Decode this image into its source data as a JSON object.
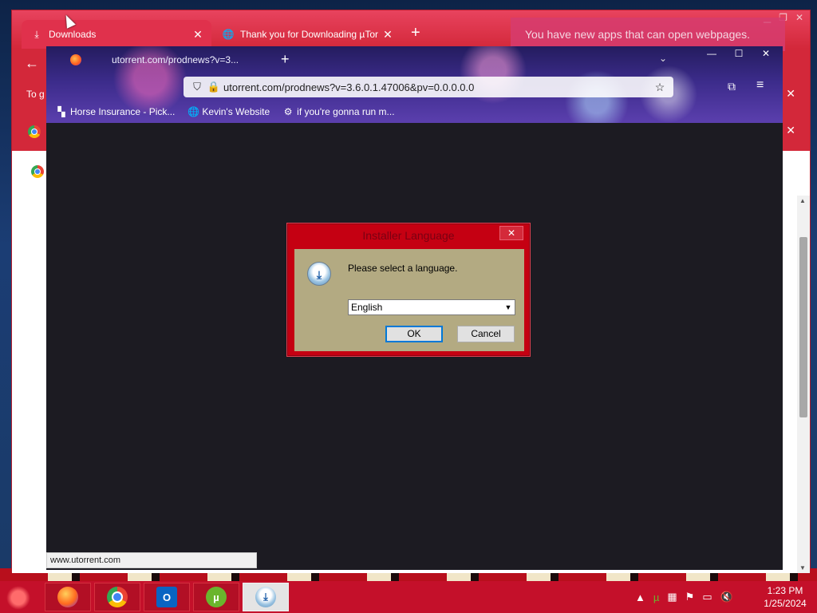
{
  "chrome": {
    "tabs": [
      {
        "label": "Downloads",
        "icon": "download-icon"
      },
      {
        "label": "Thank you for Downloading µTor",
        "icon": "globe-icon"
      }
    ],
    "sidebar_text": "To g"
  },
  "notification": {
    "text": "You have new apps that can open webpages."
  },
  "firefox": {
    "tab_title": "utorrent.com/prodnews?v=3...",
    "url": "utorrent.com/prodnews?v=3.6.0.1.47006&pv=0.0.0.0.0",
    "bookmarks": [
      {
        "label": "Horse Insurance - Pick...",
        "icon": "bookmark-icon"
      },
      {
        "label": "Kevin's Website",
        "icon": "globe-icon"
      },
      {
        "label": "if you're gonna run m...",
        "icon": "bookmark-icon"
      }
    ],
    "status_url": "www.utorrent.com"
  },
  "dialog": {
    "title": "Installer Language",
    "message": "Please select a language.",
    "language_select": "English",
    "ok_label": "OK",
    "cancel_label": "Cancel"
  },
  "taskbar": {
    "apps": [
      "firefox-icon",
      "chrome-icon",
      "outlook-icon",
      "utorrent-icon",
      "installer-icon"
    ],
    "time": "1:23 PM",
    "date": "1/25/2024"
  },
  "colors": {
    "chrome_theme": "#d3283a",
    "taskbar": "#c4102a",
    "dialog_frame": "#c50012",
    "dialog_body": "#b3aa82",
    "firefox_content": "#1c1b22"
  }
}
